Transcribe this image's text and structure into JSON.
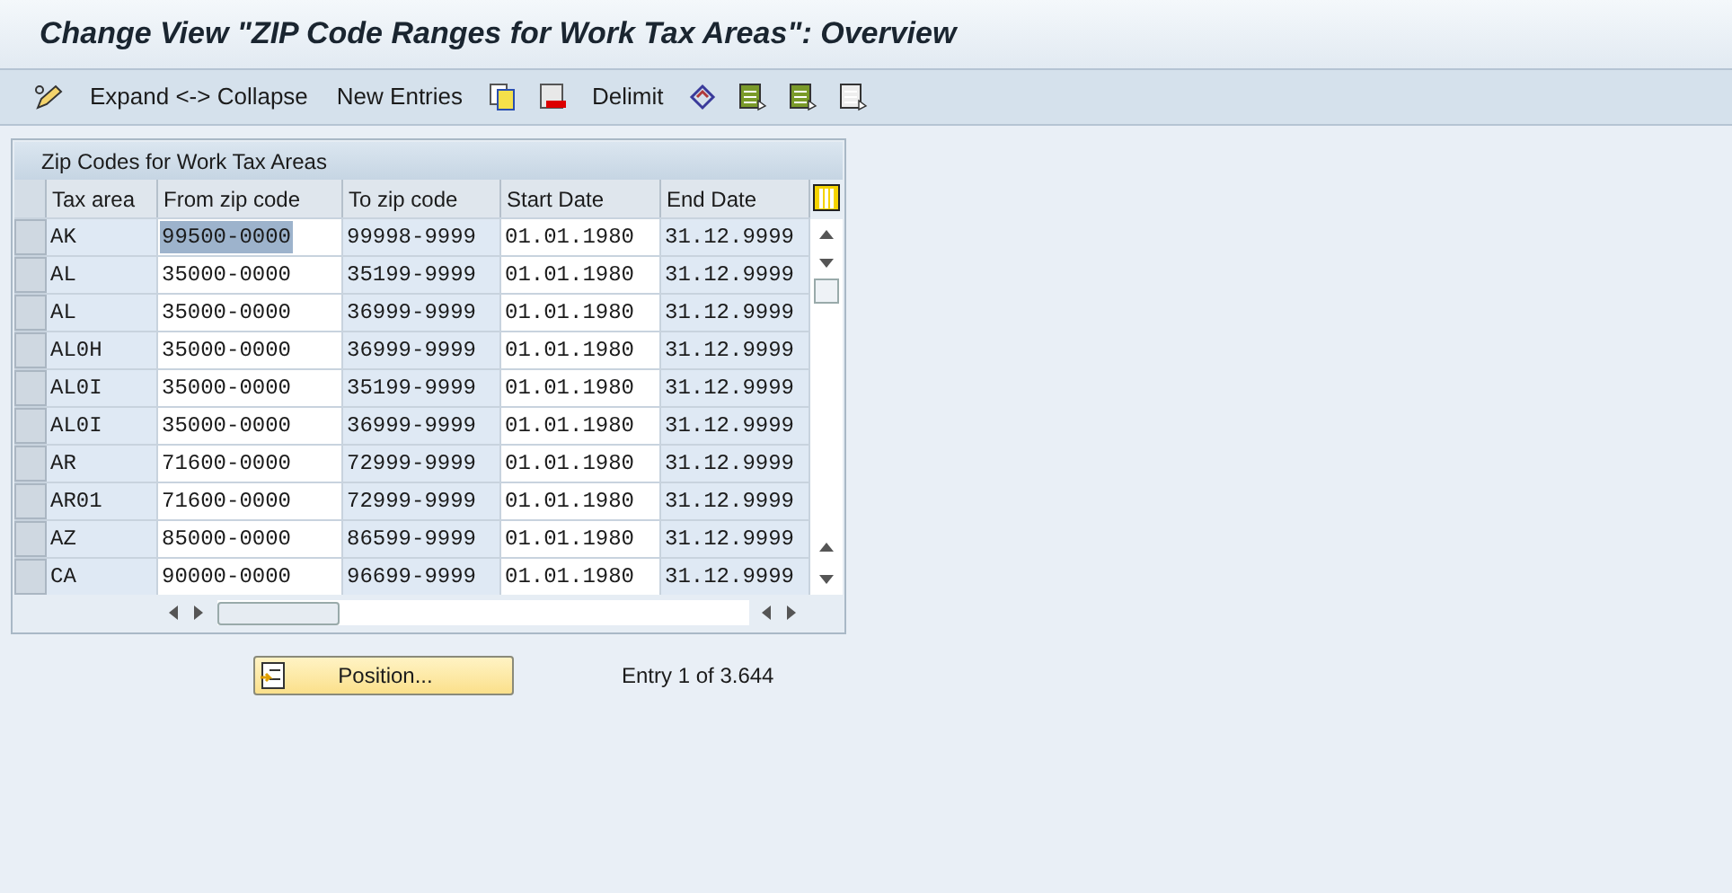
{
  "window": {
    "title": "Change View \"ZIP Code Ranges for Work Tax Areas\": Overview"
  },
  "toolbar": [
    {
      "kind": "pencil"
    },
    {
      "kind": "text",
      "label": "Expand <-> Collapse"
    },
    {
      "kind": "text",
      "label": "New Entries"
    },
    {
      "kind": "copy"
    },
    {
      "kind": "delete"
    },
    {
      "kind": "text",
      "label": "Delimit"
    },
    {
      "kind": "diamond"
    },
    {
      "kind": "select"
    },
    {
      "kind": "block"
    },
    {
      "kind": "deselect"
    }
  ],
  "table": {
    "title": "Zip Codes for Work Tax Areas",
    "columns": [
      {
        "label": "Tax area",
        "editable": false
      },
      {
        "label": "From zip code",
        "editable": true
      },
      {
        "label": "To zip code",
        "editable": false
      },
      {
        "label": "Start Date",
        "editable": true
      },
      {
        "label": "End Date",
        "editable": false
      }
    ],
    "rows": [
      [
        {
          "text": "AK",
          "selected": false
        },
        {
          "text": "99500-0000",
          "selected": true
        },
        {
          "text": "99998-9999",
          "selected": false
        },
        {
          "text": "01.01.1980",
          "selected": false
        },
        {
          "text": "31.12.9999",
          "selected": false
        }
      ],
      [
        {
          "text": "AL",
          "selected": false
        },
        {
          "text": "35000-0000",
          "selected": false
        },
        {
          "text": "35199-9999",
          "selected": false
        },
        {
          "text": "01.01.1980",
          "selected": false
        },
        {
          "text": "31.12.9999",
          "selected": false
        }
      ],
      [
        {
          "text": "AL",
          "selected": false
        },
        {
          "text": "35000-0000",
          "selected": false
        },
        {
          "text": "36999-9999",
          "selected": false
        },
        {
          "text": "01.01.1980",
          "selected": false
        },
        {
          "text": "31.12.9999",
          "selected": false
        }
      ],
      [
        {
          "text": "AL0H",
          "selected": false
        },
        {
          "text": "35000-0000",
          "selected": false
        },
        {
          "text": "36999-9999",
          "selected": false
        },
        {
          "text": "01.01.1980",
          "selected": false
        },
        {
          "text": "31.12.9999",
          "selected": false
        }
      ],
      [
        {
          "text": "AL0I",
          "selected": false
        },
        {
          "text": "35000-0000",
          "selected": false
        },
        {
          "text": "35199-9999",
          "selected": false
        },
        {
          "text": "01.01.1980",
          "selected": false
        },
        {
          "text": "31.12.9999",
          "selected": false
        }
      ],
      [
        {
          "text": "AL0I",
          "selected": false
        },
        {
          "text": "35000-0000",
          "selected": false
        },
        {
          "text": "36999-9999",
          "selected": false
        },
        {
          "text": "01.01.1980",
          "selected": false
        },
        {
          "text": "31.12.9999",
          "selected": false
        }
      ],
      [
        {
          "text": "AR",
          "selected": false
        },
        {
          "text": "71600-0000",
          "selected": false
        },
        {
          "text": "72999-9999",
          "selected": false
        },
        {
          "text": "01.01.1980",
          "selected": false
        },
        {
          "text": "31.12.9999",
          "selected": false
        }
      ],
      [
        {
          "text": "AR01",
          "selected": false
        },
        {
          "text": "71600-0000",
          "selected": false
        },
        {
          "text": "72999-9999",
          "selected": false
        },
        {
          "text": "01.01.1980",
          "selected": false
        },
        {
          "text": "31.12.9999",
          "selected": false
        }
      ],
      [
        {
          "text": "AZ",
          "selected": false
        },
        {
          "text": "85000-0000",
          "selected": false
        },
        {
          "text": "86599-9999",
          "selected": false
        },
        {
          "text": "01.01.1980",
          "selected": false
        },
        {
          "text": "31.12.9999",
          "selected": false
        }
      ],
      [
        {
          "text": "CA",
          "selected": false
        },
        {
          "text": "90000-0000",
          "selected": false
        },
        {
          "text": "96699-9999",
          "selected": false
        },
        {
          "text": "01.01.1980",
          "selected": false
        },
        {
          "text": "31.12.9999",
          "selected": false
        }
      ]
    ]
  },
  "position_button": {
    "label": "Position..."
  },
  "entry_info": "Entry 1 of 3.644"
}
